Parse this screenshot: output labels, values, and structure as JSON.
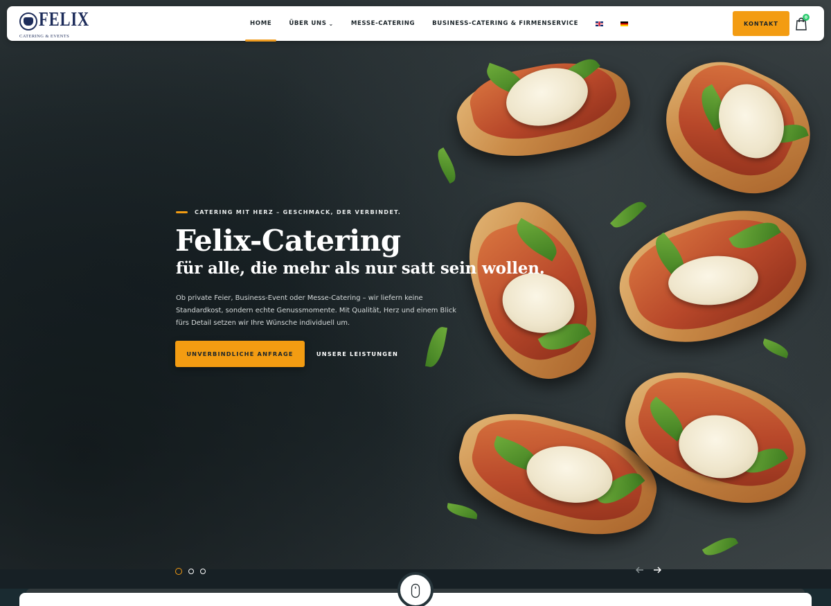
{
  "brand": {
    "logo_word": "FELIX",
    "logo_sub": "CATERING & EVENTS"
  },
  "nav": {
    "items": [
      {
        "label": "HOME",
        "active": true
      },
      {
        "label": "ÜBER UNS",
        "has_dropdown": true
      },
      {
        "label": "MESSE-CATERING"
      },
      {
        "label": "BUSINESS-CATERING & FIRMENSERVICE"
      }
    ],
    "languages": [
      "english-flag-icon",
      "german-flag-icon"
    ],
    "cta_label": "KONTAKT",
    "cart_icon": "shopping-bag-icon",
    "cart_count": "0"
  },
  "hero": {
    "eyebrow": "CATERING MIT HERZ – GESCHMACK, DER VERBINDET.",
    "title": "Felix-Catering",
    "subtitle": "für alle, die mehr als nur satt sein wollen.",
    "intro": "Ob private Feier, Business-Event oder Messe-Catering – wir liefern keine Standardkost, sondern echte Genussmomente. Mit Qualität, Herz und einem Blick fürs Detail setzen wir Ihre Wünsche individuell um.",
    "primary_button": "UNVERBINDLICHE ANFRAGE",
    "secondary_button": "UNSERE LEISTUNGEN"
  },
  "slider": {
    "slide_count": 3,
    "active_index": 0,
    "prev_icon": "arrow-left-icon",
    "next_icon": "arrow-right-icon"
  },
  "scroll_icon": "mouse-icon",
  "colors": {
    "accent": "#f39c12",
    "navy": "#1d2c5a",
    "dark": "#1b2326"
  }
}
